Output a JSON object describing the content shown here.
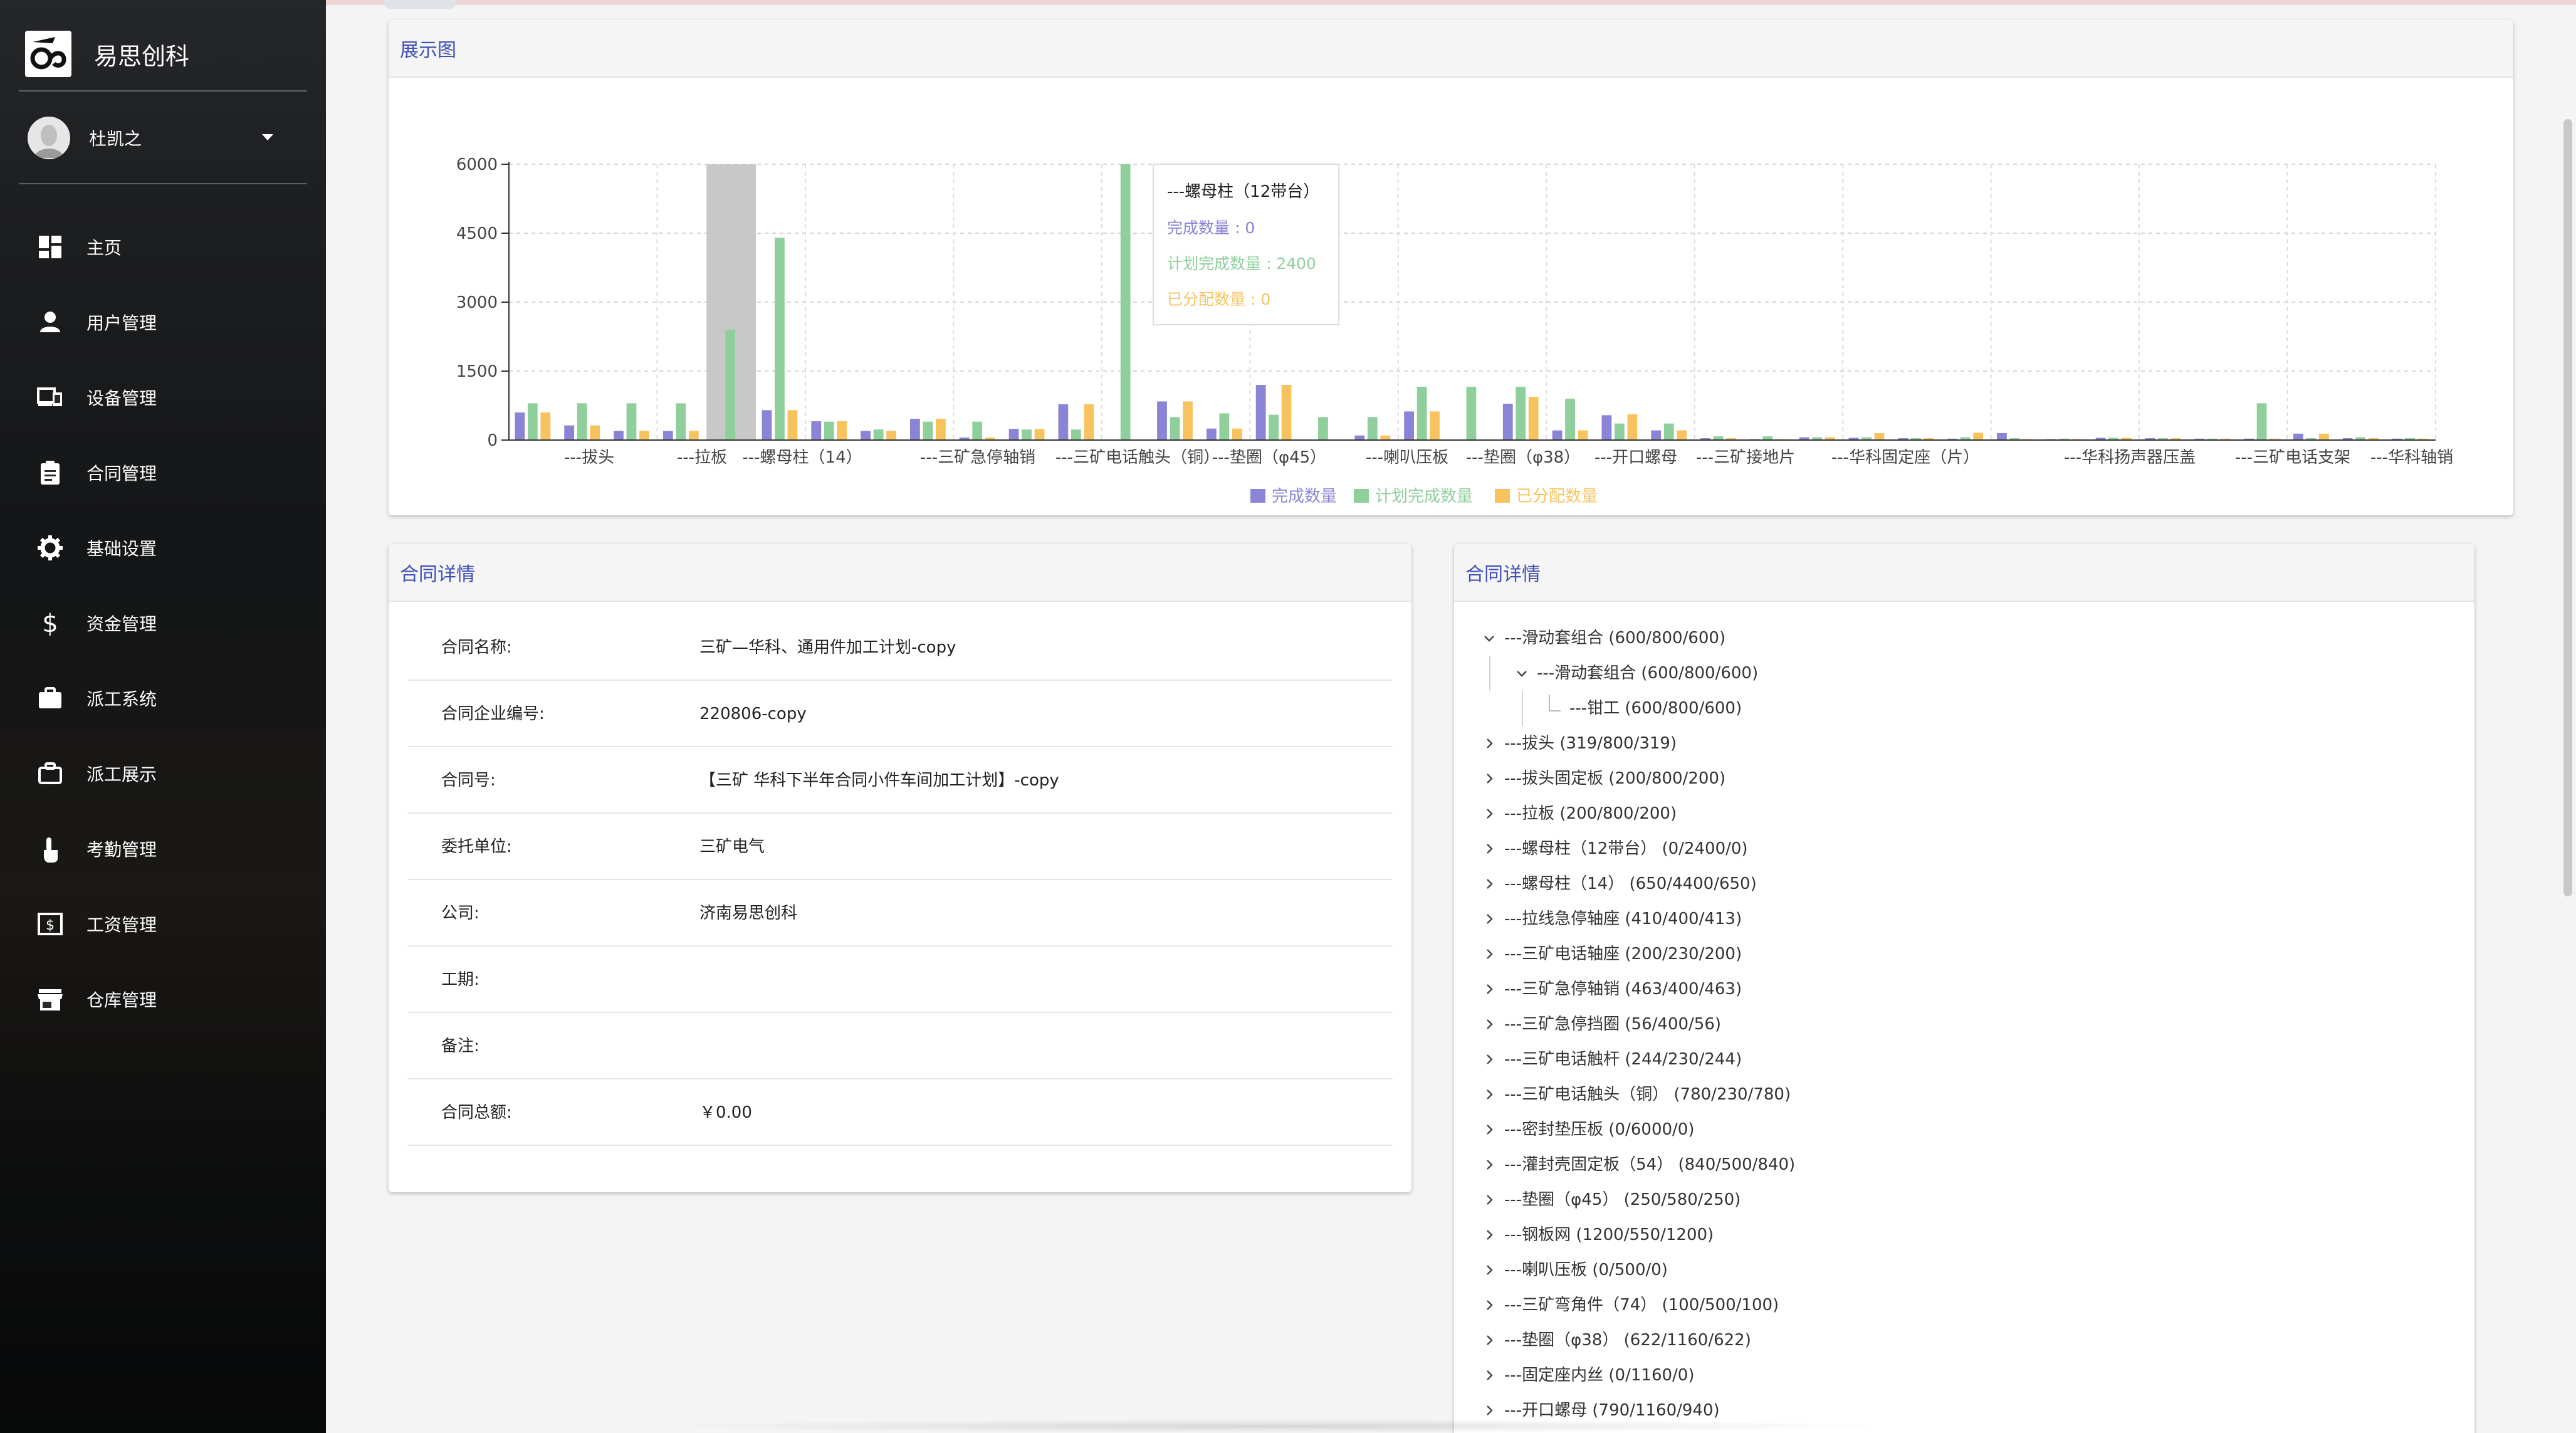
{
  "app": {
    "brand_title": "易思创科"
  },
  "user": {
    "name": "杜凯之"
  },
  "nav": [
    {
      "label": "主页",
      "icon": "dashboard-icon"
    },
    {
      "label": "用户管理",
      "icon": "person-icon"
    },
    {
      "label": "设备管理",
      "icon": "devices-icon"
    },
    {
      "label": "合同管理",
      "icon": "clipboard-icon"
    },
    {
      "label": "基础设置",
      "icon": "gear-icon"
    },
    {
      "label": "资金管理",
      "icon": "dollar-icon"
    },
    {
      "label": "派工系统",
      "icon": "briefcase-icon"
    },
    {
      "label": "派工展示",
      "icon": "briefcase-outline-icon"
    },
    {
      "label": "考勤管理",
      "icon": "touch-icon"
    },
    {
      "label": "工资管理",
      "icon": "money-icon"
    },
    {
      "label": "仓库管理",
      "icon": "store-icon"
    }
  ],
  "chart_card": {
    "title": "展示图"
  },
  "detail_card": {
    "title": "合同详情"
  },
  "tree_card": {
    "title": "合同详情"
  },
  "tooltip": {
    "title": "---螺母柱（12带台）",
    "lines": [
      "完成数量 : 0",
      "计划完成数量 : 2400",
      "已分配数量 : 0"
    ]
  },
  "colors": {
    "completed": "#8a84d6",
    "planned": "#8fcf9b",
    "assigned": "#f7c35f",
    "accent": "#3f51b5"
  },
  "chart_data": {
    "type": "bar",
    "yticks": [
      "6000",
      "4500",
      "3000",
      "1500",
      "0"
    ],
    "ylim": [
      0,
      6000
    ],
    "x_labels_shown": [
      "---拔头",
      "---拉板",
      "---螺母柱（14）",
      "---三矿急停轴销",
      "---三矿电话触头（铜）",
      "---垫圈（φ45）",
      "---喇叭压板",
      "---垫圈（φ38）",
      "---开口螺母",
      "---三矿接地片",
      "---华科固定座（片）",
      "---华科扬声器压盖",
      "---三矿电话支架",
      "---华科轴销"
    ],
    "legend": [
      "完成数量",
      "计划完成数量",
      "已分配数量"
    ],
    "series": [
      {
        "name": "完成数量",
        "values": [
          600,
          319,
          200,
          200,
          0,
          650,
          410,
          200,
          463,
          56,
          244,
          780,
          0,
          840,
          250,
          1200,
          0,
          100,
          622,
          0,
          790,
          210,
          540,
          210,
          40,
          20,
          60,
          50,
          40,
          30,
          150,
          20,
          50,
          40,
          30,
          30,
          140,
          40,
          30
        ]
      },
      {
        "name": "计划完成数量",
        "values": [
          800,
          800,
          800,
          800,
          2400,
          4400,
          400,
          230,
          400,
          400,
          230,
          230,
          6000,
          500,
          580,
          550,
          500,
          500,
          1160,
          1160,
          1160,
          900,
          360,
          360,
          80,
          80,
          60,
          60,
          40,
          60,
          40,
          30,
          50,
          40,
          30,
          800,
          40,
          60,
          40
        ]
      },
      {
        "name": "已分配数量",
        "values": [
          600,
          319,
          200,
          200,
          0,
          650,
          413,
          200,
          463,
          56,
          244,
          780,
          0,
          840,
          250,
          1200,
          0,
          100,
          622,
          0,
          940,
          210,
          560,
          210,
          40,
          20,
          60,
          150,
          40,
          160,
          20,
          20,
          50,
          40,
          30,
          30,
          140,
          40,
          30
        ]
      }
    ],
    "highlight_index": 4
  },
  "detail": [
    {
      "key": "合同名称:",
      "value": "三矿—华科、通用件加工计划-copy"
    },
    {
      "key": "合同企业编号:",
      "value": "220806-copy"
    },
    {
      "key": "合同号:",
      "value": "【三矿 华科下半年合同小件车间加工计划】-copy"
    },
    {
      "key": "委托单位:",
      "value": "三矿电气"
    },
    {
      "key": "公司:",
      "value": "济南易思创科"
    },
    {
      "key": "工期:",
      "value": ""
    },
    {
      "key": "备注:",
      "value": ""
    },
    {
      "key": "合同总额:",
      "value": "￥0.00"
    }
  ],
  "tree": [
    {
      "text": "---滑动套组合 (600/800/600)",
      "level": 0,
      "toggle": "expanded"
    },
    {
      "text": "---滑动套组合 (600/800/600)",
      "level": 1,
      "toggle": "expanded"
    },
    {
      "text": "---钳工 (600/800/600)",
      "level": 2,
      "toggle": "leaf"
    },
    {
      "text": "---拔头 (319/800/319)",
      "level": 0,
      "toggle": "collapsed"
    },
    {
      "text": "---拔头固定板 (200/800/200)",
      "level": 0,
      "toggle": "collapsed"
    },
    {
      "text": "---拉板 (200/800/200)",
      "level": 0,
      "toggle": "collapsed"
    },
    {
      "text": "---螺母柱（12带台） (0/2400/0)",
      "level": 0,
      "toggle": "collapsed"
    },
    {
      "text": "---螺母柱（14） (650/4400/650)",
      "level": 0,
      "toggle": "collapsed"
    },
    {
      "text": "---拉线急停轴座 (410/400/413)",
      "level": 0,
      "toggle": "collapsed"
    },
    {
      "text": "---三矿电话轴座 (200/230/200)",
      "level": 0,
      "toggle": "collapsed"
    },
    {
      "text": "---三矿急停轴销 (463/400/463)",
      "level": 0,
      "toggle": "collapsed"
    },
    {
      "text": "---三矿急停挡圈 (56/400/56)",
      "level": 0,
      "toggle": "collapsed"
    },
    {
      "text": "---三矿电话触杆 (244/230/244)",
      "level": 0,
      "toggle": "collapsed"
    },
    {
      "text": "---三矿电话触头（铜） (780/230/780)",
      "level": 0,
      "toggle": "collapsed"
    },
    {
      "text": "---密封垫压板 (0/6000/0)",
      "level": 0,
      "toggle": "collapsed"
    },
    {
      "text": "---灌封壳固定板（54） (840/500/840)",
      "level": 0,
      "toggle": "collapsed"
    },
    {
      "text": "---垫圈（φ45） (250/580/250)",
      "level": 0,
      "toggle": "collapsed"
    },
    {
      "text": "---钢板网 (1200/550/1200)",
      "level": 0,
      "toggle": "collapsed"
    },
    {
      "text": "---喇叭压板 (0/500/0)",
      "level": 0,
      "toggle": "collapsed"
    },
    {
      "text": "---三矿弯角件（74） (100/500/100)",
      "level": 0,
      "toggle": "collapsed"
    },
    {
      "text": "---垫圈（φ38） (622/1160/622)",
      "level": 0,
      "toggle": "collapsed"
    },
    {
      "text": "---固定座内丝 (0/1160/0)",
      "level": 0,
      "toggle": "collapsed"
    },
    {
      "text": "---开口螺母 (790/1160/940)",
      "level": 0,
      "toggle": "collapsed"
    }
  ]
}
